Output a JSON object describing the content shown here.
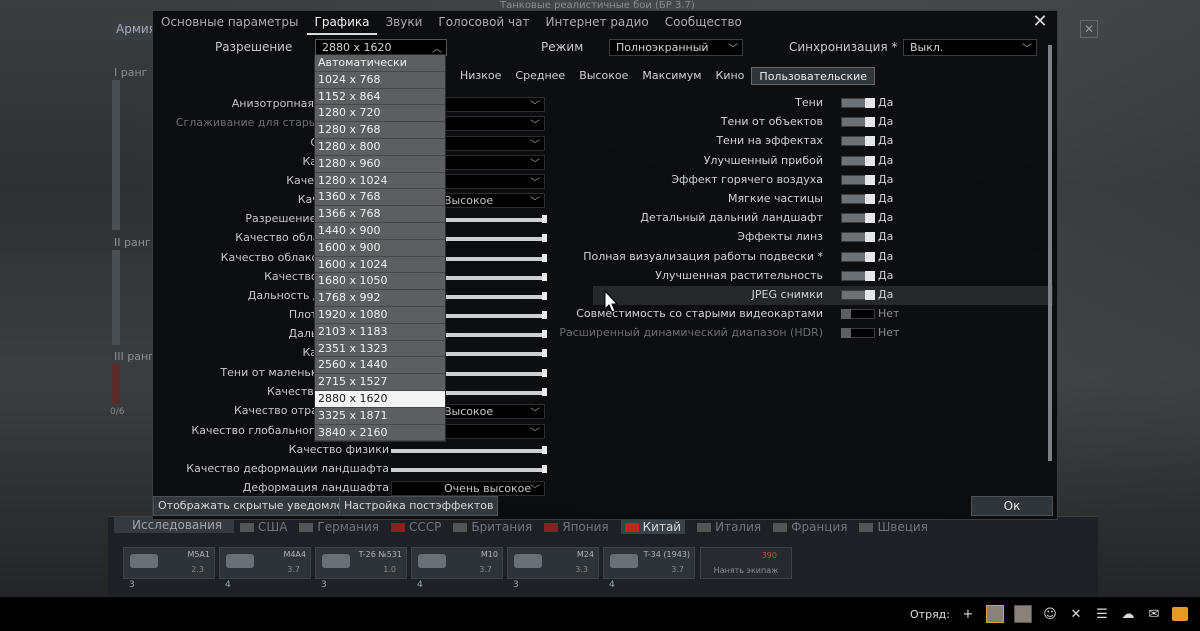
{
  "background": {
    "top_title": "Танковые реалистичные бои (БР 3.7)",
    "army_tab": "Армия",
    "close_glyph": "✕",
    "ranks": [
      "I ранг",
      "II ранг",
      "III ранг"
    ],
    "rank_count": "0/6"
  },
  "research": {
    "tab_label": "Исследования",
    "nations": [
      {
        "name": "США",
        "active": false
      },
      {
        "name": "Германия",
        "active": false
      },
      {
        "name": "СССР",
        "active": false
      },
      {
        "name": "Британия",
        "active": false
      },
      {
        "name": "Япония",
        "active": false
      },
      {
        "name": "Китай",
        "active": true
      },
      {
        "name": "Италия",
        "active": false
      },
      {
        "name": "Франция",
        "active": false
      },
      {
        "name": "Швеция",
        "active": false
      }
    ],
    "vehicles": [
      {
        "name": "M5A1",
        "br": "2.3",
        "count": "3"
      },
      {
        "name": "M4A4",
        "br": "3.7",
        "count": "4"
      },
      {
        "name": "T-26 №531",
        "br": "1.0",
        "count": "3"
      },
      {
        "name": "M10",
        "br": "3.7",
        "count": "4"
      },
      {
        "name": "M24",
        "br": "3.3",
        "count": "3"
      },
      {
        "name": "T-34 (1943)",
        "br": "3.7",
        "count": "4"
      }
    ],
    "crew_slot": "Нанять экипаж",
    "crew_cost": "390"
  },
  "taskbar": {
    "squad_label": "Отряд:",
    "plus": "+",
    "close": "✕"
  },
  "dialog": {
    "tabs": [
      {
        "label": "Основные параметры",
        "active": false
      },
      {
        "label": "Графика",
        "active": true
      },
      {
        "label": "Звуки",
        "active": false
      },
      {
        "label": "Голосовой чат",
        "active": false
      },
      {
        "label": "Интернет радио",
        "active": false
      },
      {
        "label": "Сообщество",
        "active": false
      }
    ],
    "close_glyph": "✕",
    "resolution_label": "Разрешение",
    "resolution_value": "2880 x 1620",
    "mode_label": "Режим",
    "mode_value": "Полноэкранный",
    "vsync_label": "Синхронизация *",
    "vsync_value": "Выкл.",
    "presets": [
      {
        "label": "Низкое",
        "active": false
      },
      {
        "label": "Среднее",
        "active": false
      },
      {
        "label": "Высокое",
        "active": false
      },
      {
        "label": "Максимум",
        "active": false
      },
      {
        "label": "Кино",
        "active": false
      },
      {
        "label": "Пользовательские",
        "active": true
      }
    ],
    "left_settings": [
      {
        "label": "Анизотропная фильтрация",
        "control": "select",
        "value": "",
        "dim": false
      },
      {
        "label": "Сглаживание для старых видеокарт",
        "control": "select",
        "value": "",
        "dim": true
      },
      {
        "label": "Сглаживание",
        "control": "select",
        "value": "",
        "dim": false
      },
      {
        "label": "Качество SSAA",
        "control": "select",
        "value": "",
        "dim": false
      },
      {
        "label": "Качество текстур",
        "control": "select",
        "value": "",
        "dim": false
      },
      {
        "label": "Качество теней",
        "control": "select",
        "value": "Высокое",
        "dim": false
      },
      {
        "label": "Разрешение рендеринга",
        "control": "slider",
        "value": "",
        "dim": false
      },
      {
        "label": "Качество облаков (в небе)",
        "control": "slider",
        "value": "",
        "dim": false
      },
      {
        "label": "Качество облаков (на земле)",
        "control": "slider",
        "value": "",
        "dim": false
      },
      {
        "label": "Качество ландшафта",
        "control": "slider",
        "value": "",
        "dim": false
      },
      {
        "label": "Дальность детализации",
        "control": "slider",
        "value": "",
        "dim": false
      },
      {
        "label": "Плотность травы",
        "control": "slider",
        "value": "",
        "dim": false
      },
      {
        "label": "Дальность травы",
        "control": "slider",
        "value": "",
        "dim": false
      },
      {
        "label": "Качество воды",
        "control": "slider",
        "value": "",
        "dim": false
      },
      {
        "label": "Тени от маленьких объектов",
        "control": "slider",
        "value": "",
        "dim": false
      },
      {
        "label": "Качество отражений",
        "control": "slider",
        "value": "",
        "dim": false
      },
      {
        "label": "Качество отражений воды",
        "control": "select",
        "value": "Высокое",
        "dim": false
      },
      {
        "label": "Качество глобального освещения",
        "control": "select",
        "value": "",
        "dim": false
      },
      {
        "label": "Качество физики",
        "control": "slider",
        "value": "",
        "dim": false
      },
      {
        "label": "Качество деформации ландшафта",
        "control": "slider",
        "value": "",
        "dim": false
      },
      {
        "label": "Деформация ландшафта",
        "control": "select",
        "value": "Очень высокое",
        "dim": false
      }
    ],
    "right_settings": [
      {
        "label": "Тени",
        "state": "on",
        "value": "Да",
        "dim": false,
        "highlight": false
      },
      {
        "label": "Тени от объектов",
        "state": "on",
        "value": "Да",
        "dim": false,
        "highlight": false
      },
      {
        "label": "Тени на эффектах",
        "state": "on",
        "value": "Да",
        "dim": false,
        "highlight": false
      },
      {
        "label": "Улучшенный прибой",
        "state": "on",
        "value": "Да",
        "dim": false,
        "highlight": false
      },
      {
        "label": "Эффект горячего воздуха",
        "state": "on",
        "value": "Да",
        "dim": false,
        "highlight": false
      },
      {
        "label": "Мягкие частицы",
        "state": "on",
        "value": "Да",
        "dim": false,
        "highlight": false
      },
      {
        "label": "Детальный дальний ландшафт",
        "state": "on",
        "value": "Да",
        "dim": false,
        "highlight": false
      },
      {
        "label": "Эффекты линз",
        "state": "on",
        "value": "Да",
        "dim": false,
        "highlight": false
      },
      {
        "label": "Полная визуализация работы подвески *",
        "state": "on",
        "value": "Да",
        "dim": false,
        "highlight": false
      },
      {
        "label": "Улучшенная растительность",
        "state": "on",
        "value": "Да",
        "dim": false,
        "highlight": false
      },
      {
        "label": "JPEG снимки",
        "state": "on",
        "value": "Да",
        "dim": false,
        "highlight": true
      },
      {
        "label": "Совместимость со старыми видеокартами",
        "state": "off",
        "value": "Нет",
        "dim": false,
        "highlight": false
      },
      {
        "label": "Расширенный динамический диапазон (HDR)",
        "state": "off",
        "value": "Нет",
        "dim": true,
        "highlight": false
      }
    ],
    "show_hidden_btn": "Отображать скрытые уведомления",
    "postfx_btn": "Настройка постэффектов",
    "ok_btn": "Ок"
  },
  "resolution_options": [
    "Автоматически",
    "1024 x 768",
    "1152 x 864",
    "1280 x 720",
    "1280 x 768",
    "1280 x 800",
    "1280 x 960",
    "1280 x 1024",
    "1360 x 768",
    "1366 x 768",
    "1440 x 900",
    "1600 x 900",
    "1600 x 1024",
    "1680 x 1050",
    "1768 x 992",
    "1920 x 1080",
    "2103 x 1183",
    "2351 x 1323",
    "2560 x 1440",
    "2715 x 1527",
    "2880 x 1620",
    "3325 x 1871",
    "3840 x 2160"
  ],
  "resolution_selected": "2880 x 1620",
  "colors": {
    "accent_orange": "#e39b26",
    "dialog_bg": "#0a0b0c",
    "toggle_on": "#6c7175"
  }
}
